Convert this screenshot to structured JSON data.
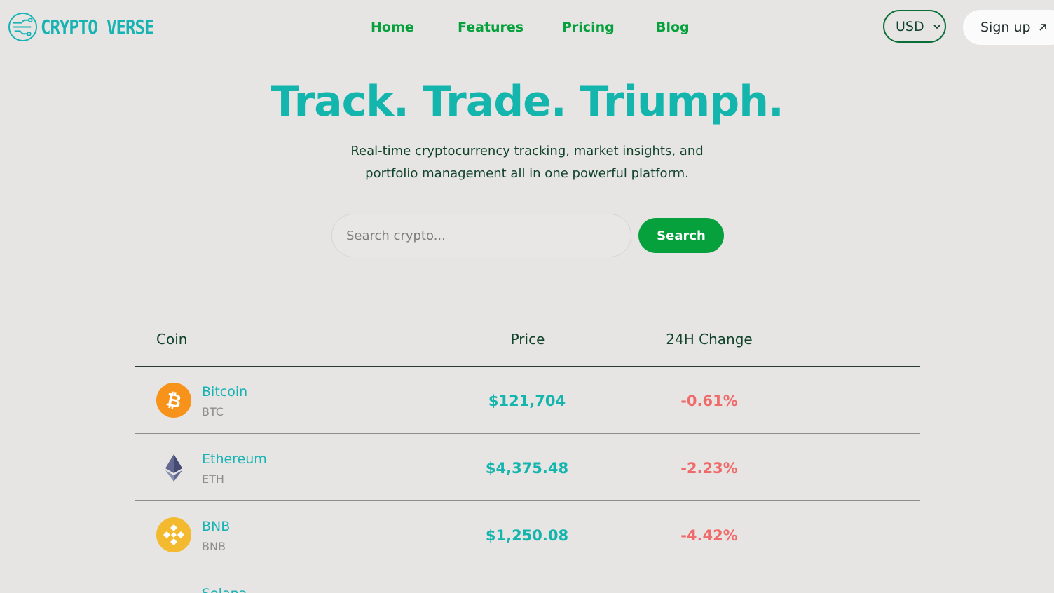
{
  "header": {
    "logo_text": "CRYPTO VERSE",
    "nav": [
      "Home",
      "Features",
      "Pricing",
      "Blog"
    ],
    "currency": "USD",
    "signup_label": "Sign up"
  },
  "hero": {
    "title": "Track. Trade. Triumph.",
    "subtitle_line1": "Real-time cryptocurrency tracking, market insights, and",
    "subtitle_line2": "portfolio management all in one powerful platform."
  },
  "search": {
    "placeholder": "Search crypto...",
    "button_label": "Search"
  },
  "table": {
    "headers": {
      "coin": "Coin",
      "price": "Price",
      "change": "24H Change"
    },
    "rows": [
      {
        "name": "Bitcoin",
        "symbol": "BTC",
        "price": "$121,704",
        "change": "-0.61%",
        "icon": "bitcoin-icon"
      },
      {
        "name": "Ethereum",
        "symbol": "ETH",
        "price": "$4,375.48",
        "change": "-2.23%",
        "icon": "ethereum-icon"
      },
      {
        "name": "BNB",
        "symbol": "BNB",
        "price": "$1,250.08",
        "change": "-4.42%",
        "icon": "bnb-icon"
      },
      {
        "name": "Solana",
        "icon": "solana-icon"
      }
    ]
  },
  "colors": {
    "background": "#e6e5e4",
    "brand_teal": "#13b5ad",
    "nav_green": "#06a13d",
    "negative_red": "#f06a6a"
  }
}
